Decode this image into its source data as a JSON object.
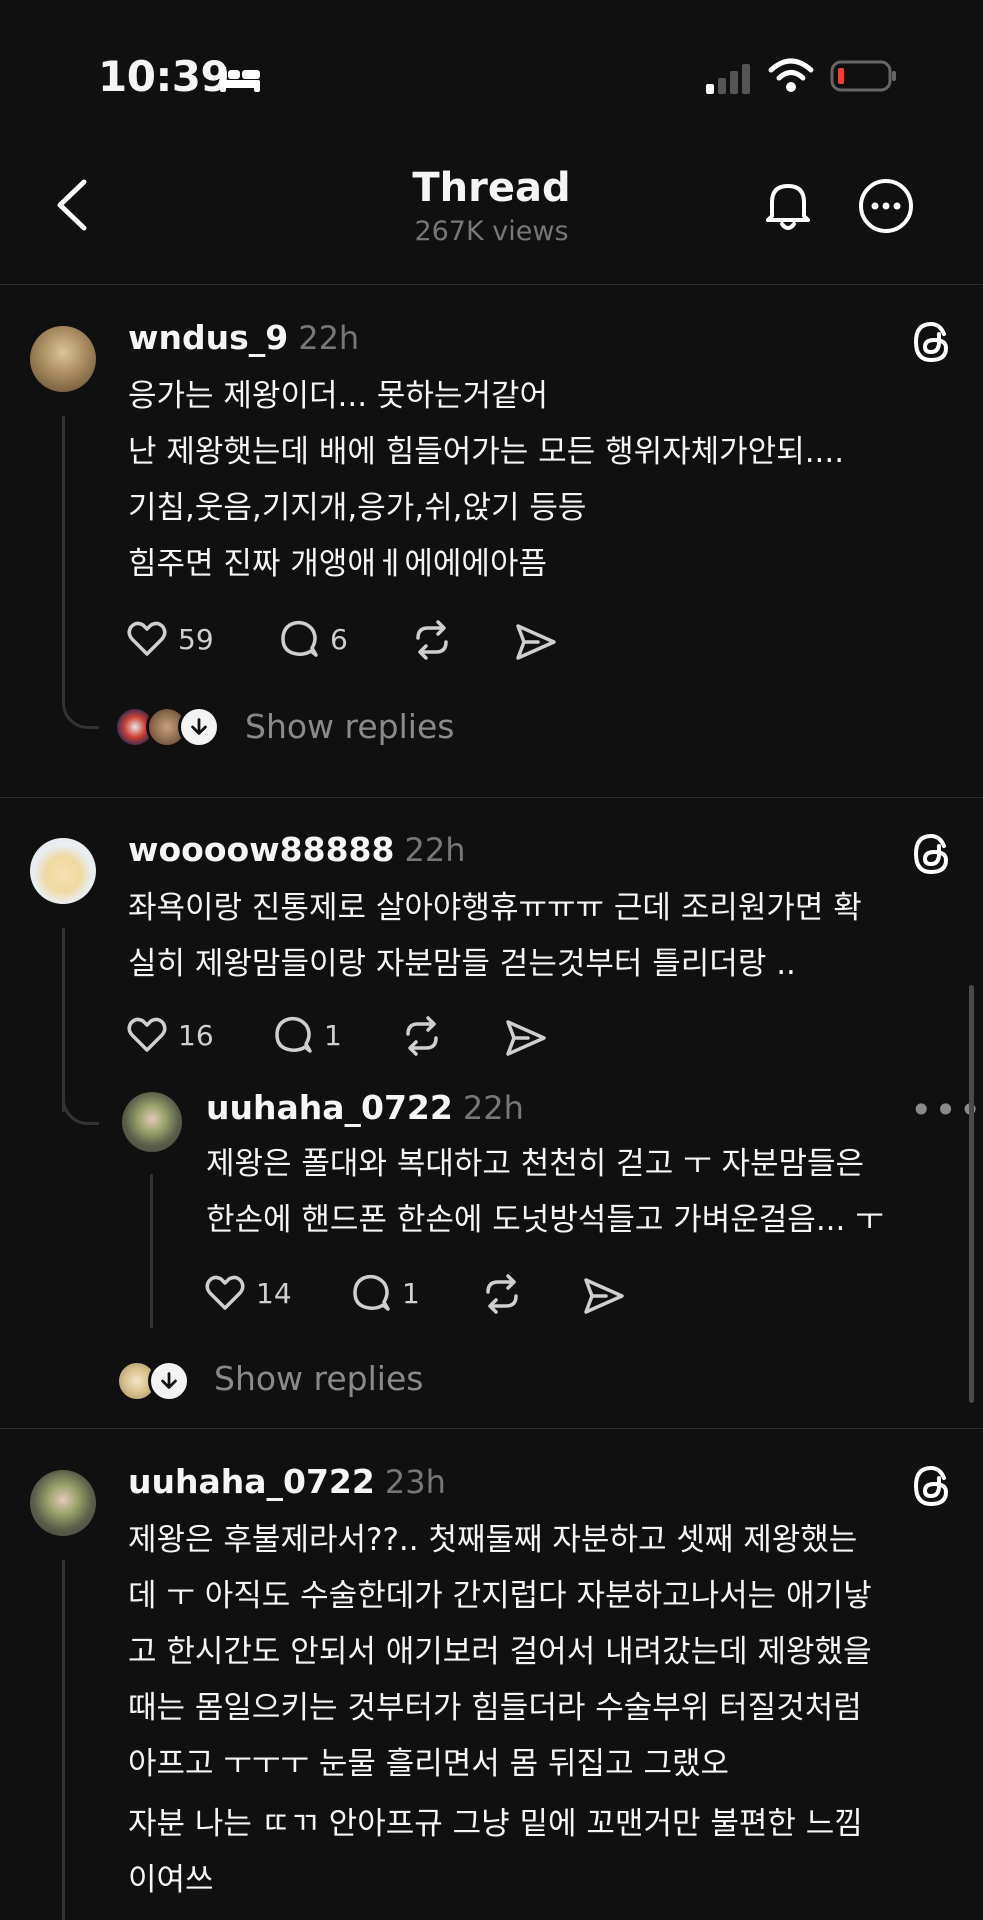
{
  "status_bar": {
    "time": "10:39"
  },
  "header": {
    "title": "Thread",
    "views": "267K views"
  },
  "posts": [
    {
      "username": "wndus_9",
      "age": "22h",
      "text": "응가는 제왕이더... 못하는거같어\n난 제왕햇는데 배에 힘들어가는 모든 행위자체가안되....\n기침,웃음,기지개,응가,쉬,앉기 등등\n힘주면 진짜 개앵애ㅔ에에에아픔",
      "likes": "59",
      "replies": "6",
      "show_replies": "Show replies"
    },
    {
      "username": "woooow88888",
      "age": "22h",
      "text": "좌욕이랑 진통제로 살아야행휴ㅠㅠㅠ 근데 조리원가면 확\n실히 제왕맘들이랑 자분맘들 걷는것부터 틀리더랑 ..",
      "likes": "16",
      "replies": "1"
    },
    {
      "username": "uuhaha_0722",
      "age": "22h",
      "text": "제왕은 폴대와 복대하고 천천히 걷고 ㅜ 자분맘들은\n한손에 핸드폰 한손에 도넛방석들고 가벼운걸음... ㅜ",
      "likes": "14",
      "replies": "1",
      "show_replies": "Show replies"
    },
    {
      "username": "uuhaha_0722",
      "age": "23h",
      "text": "제왕은 후불제라서??.. 첫째둘째 자분하고 셋째 제왕했는\n데 ㅜ 아직도 수술한데가 간지럽다 자분하고나서는 애기낳\n고 한시간도 안되서 애기보러 걸어서 내려갔는데 제왕했을\n때는 몸일으키는 것부터가 힘들더라 수술부위 터질것처럼\n아프고 ㅜㅜㅜ 눈물 흘리면서 몸 뒤집고 그랬오",
      "text2": "자분 나는 ㄸㄲ 안아프규 그냥 밑에 꼬맨거만 불편한 느낌\n이여쓰"
    }
  ],
  "colors": {
    "background": "#101010",
    "text": "#f3f5f7",
    "muted": "#777777",
    "battery_low": "#ff3b30"
  }
}
